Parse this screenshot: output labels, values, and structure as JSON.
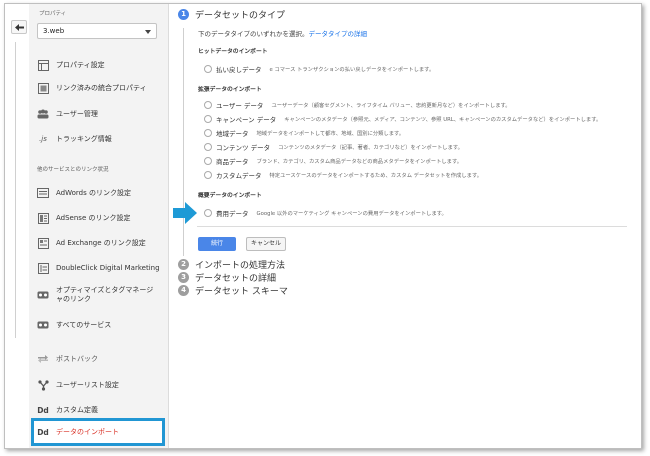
{
  "sidebar": {
    "property_label": "プロパティ",
    "property_value": "3.web",
    "items": [
      {
        "label": "プロパティ設定",
        "icon": "property-settings-icon"
      },
      {
        "label": "リンク済みの統合プロパティ",
        "icon": "rollup-property-icon"
      },
      {
        "label": "ユーザー管理",
        "icon": "users-icon"
      },
      {
        "label": "トラッキング情報",
        "icon": "js-icon"
      }
    ],
    "section_label": "他のサービスとのリンク状況",
    "link_items": [
      {
        "label": "AdWords のリンク設定",
        "icon": "adwords-icon"
      },
      {
        "label": "AdSense のリンク設定",
        "icon": "adsense-icon"
      },
      {
        "label": "Ad Exchange のリンク設定",
        "icon": "adexchange-icon"
      },
      {
        "label": "DoubleClick Digital Marketing",
        "icon": "doubleclick-icon"
      },
      {
        "label": "オプティマイズとタグマネージャのリンク",
        "icon": "optimize-icon"
      },
      {
        "label": "すべてのサービス",
        "icon": "all-services-icon"
      }
    ],
    "lower_items": [
      {
        "label": "ポストバック",
        "icon": "postback-icon"
      },
      {
        "label": "ユーザーリスト設定",
        "icon": "user-list-icon"
      },
      {
        "label": "カスタム定義",
        "icon": "dd-icon",
        "icon_text": "Dd"
      },
      {
        "label": "データのインポート",
        "icon": "dd-icon",
        "icon_text": "Dd",
        "active": true
      }
    ]
  },
  "main": {
    "steps": [
      {
        "number": "1",
        "title": "データセットのタイプ",
        "active": true
      },
      {
        "number": "2",
        "title": "インポートの処理方法"
      },
      {
        "number": "3",
        "title": "データセットの詳細"
      },
      {
        "number": "4",
        "title": "データセット スキーマ"
      }
    ],
    "intro_text": "下のデータタイプのいずれかを選択。",
    "intro_link": "データタイプの詳細",
    "sections": {
      "hit": "ヒットデータのインポート",
      "extended": "拡張データのインポート",
      "summary": "概要データのインポート"
    },
    "hit_options": [
      {
        "label": "払い戻しデータ",
        "desc": "e コマース トランザクションの払い戻しデータをインポートします。"
      }
    ],
    "extended_options": [
      {
        "label": "ユーザー データ",
        "desc": "ユーザーデータ（顧客セグメント、ライフタイム バリュー、忠約更新月など）をインポートします。"
      },
      {
        "label": "キャンペーン データ",
        "desc": "キャンペーンのメタデータ（参照元、メディア、コンテンツ、参照 URL、キャンペーンのカスタムデータなど）をインポートします。"
      },
      {
        "label": "地域データ",
        "desc": "地域データをインポートして都市、地域、国別に分類します。"
      },
      {
        "label": "コンテンツ データ",
        "desc": "コンテンツのメタデータ（記事、著者、カテゴリなど）をインポートします。"
      },
      {
        "label": "商品データ",
        "desc": "ブランド、カテゴリ、カスタム商品データなどの商品メタデータをインポートします。"
      },
      {
        "label": "カスタムデータ",
        "desc": "特定ユースケースのデータをインポートするため、カスタム データセットを作成します。"
      }
    ],
    "summary_options": [
      {
        "label": "費用データ",
        "desc": "Google 以外のマーケティング キャンペーンの費用データをインポートします。"
      }
    ],
    "continue_label": "続行",
    "cancel_label": "キャンセル"
  },
  "colors": {
    "accent": "#4a86e8",
    "highlight": "#2196d3",
    "arrow": "#1e9ad6"
  }
}
